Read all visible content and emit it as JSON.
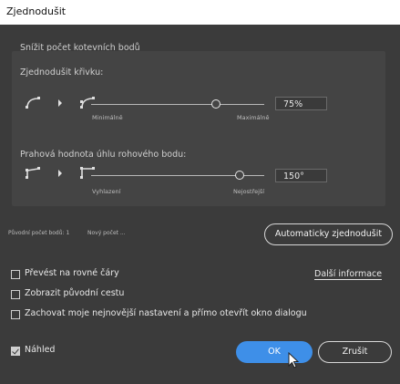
{
  "window": {
    "title": "Zjednodušit"
  },
  "section1": {
    "header": "Snížit počet kotevních bodů",
    "label": "Zjednodušit křivku:",
    "min_label": "Minimálně",
    "max_label": "Maximálně",
    "value": "75%",
    "level_percent": 75
  },
  "section2": {
    "label": "Prahová hodnota úhlu rohového bodu:",
    "min_label": "Vyhlazení",
    "max_label": "Nejostřejší",
    "value": "150°"
  },
  "counts": {
    "original": "Původní počet bodů: 1",
    "new": "Nový počet ..."
  },
  "buttons": {
    "auto_simplify": "Automaticky zjednodušit",
    "ok": "OK",
    "cancel": "Zrušit"
  },
  "options": {
    "straight_lines": "Převést na rovné čáry",
    "show_original": "Zobrazit původní cestu",
    "keep_latest": "Zachovat moje nejnovější nastavení a přímo otevřít okno dialogu",
    "more_info": "Další informace",
    "preview": "Náhled"
  }
}
